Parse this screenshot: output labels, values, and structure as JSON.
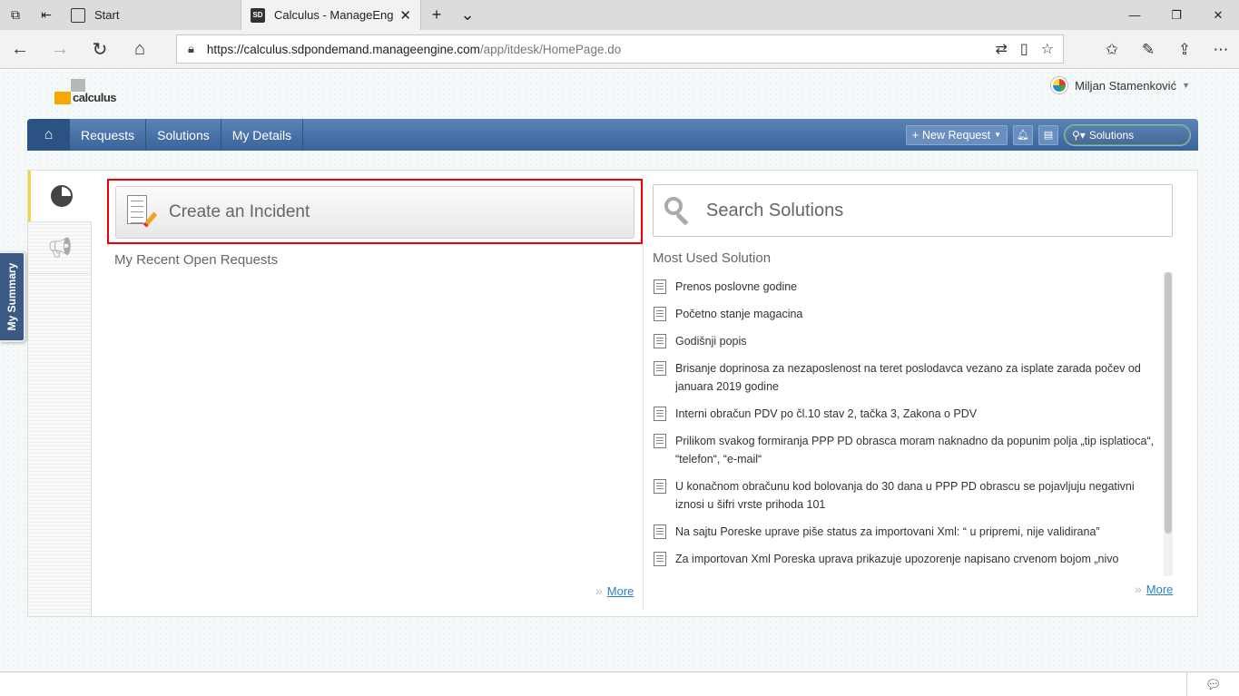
{
  "browser": {
    "tabs": [
      {
        "title": "Start",
        "icon": "start-page-icon",
        "active": false
      },
      {
        "title": "Calculus - ManageEngi",
        "icon": "sd-favicon-icon",
        "favicon_text": "SD",
        "active": true
      }
    ],
    "url_host": "https://calculus.sdpondemand.manageengine.com",
    "url_path": "/app/itdesk/HomePage.do"
  },
  "header": {
    "logo_text": "calculus",
    "user_name": "Miljan Stamenković"
  },
  "navbar": {
    "items": [
      "Requests",
      "Solutions",
      "My Details"
    ],
    "new_request_label": "New Request",
    "search_label": "Solutions",
    "accent": "#3a639a"
  },
  "sidebar": {
    "my_summary_label": "My Summary"
  },
  "main": {
    "create_incident_label": "Create an Incident",
    "recent_requests_title": "My Recent Open Requests",
    "more_label": "More",
    "search_placeholder": "Search Solutions",
    "most_used_title": "Most Used Solution",
    "solutions": [
      "Prenos poslovne godine",
      "Početno stanje magacina",
      "Godišnji popis",
      "Brisanje doprinosa za nezaposlenost na teret poslodavca vezano za isplate zarada počev od januara 2019 godine",
      "Interni obračun PDV po čl.10 stav 2, tačka 3, Zakona o PDV",
      "Prilikom svakog formiranja PPP PD obrasca moram naknadno da popunim polja „tip isplatioca“, “telefon“, “e-mail“",
      "U konačnom obračunu kod bolovanja do 30 dana u PPP PD obrascu se pojavljuju negativni iznosi u šifri vrste prihoda 101",
      "Na sajtu Poreske uprave piše status za importovani Xml: “ u pripremi, nije validirana”",
      "Za importovan Xml Poreska uprava prikazuje upozorenje napisano crvenom bojom „nivo"
    ],
    "highlight_color": "#e00000"
  }
}
